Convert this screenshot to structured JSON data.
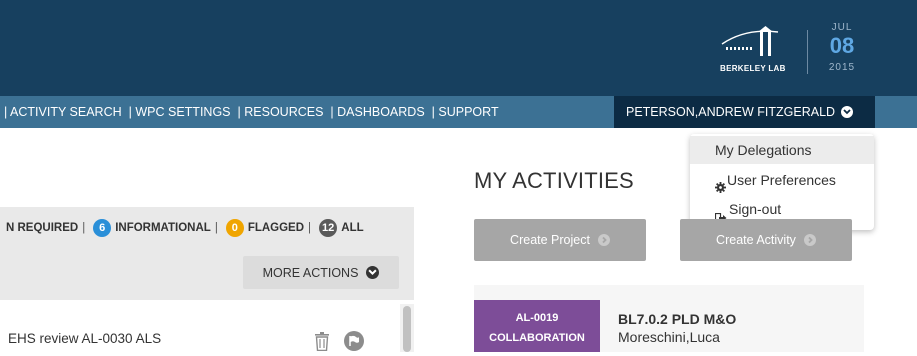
{
  "header": {
    "logo_text": "BERKELEY LAB",
    "date": {
      "month": "JUL",
      "day": "08",
      "year": "2015"
    }
  },
  "nav": {
    "items": [
      "| ACTIVITY SEARCH",
      "| WPC SETTINGS",
      "| RESOURCES",
      "| DASHBOARDS",
      "| SUPPORT"
    ],
    "user_name": "PETERSON,ANDREW FITZGERALD"
  },
  "user_dropdown": {
    "items": [
      {
        "label": "My Delegations",
        "icon": ""
      },
      {
        "label": "User Preferences",
        "icon": "gear-icon"
      },
      {
        "label": "Sign-out",
        "icon": "sign-out-icon"
      }
    ]
  },
  "main": {
    "heading": "MY ACTIVITIES",
    "create_project_label": "Create Project",
    "create_activity_label": "Create Activity"
  },
  "filters": {
    "action_required_label": "N REQUIRED",
    "informational_count": "6",
    "informational_label": "INFORMATIONAL",
    "flagged_count": "0",
    "flagged_label": "FLAGGED",
    "all_count": "12",
    "all_label": "ALL",
    "more_actions_label": "MORE ACTIONS"
  },
  "list": {
    "rows": [
      {
        "text": "EHS review AL-0030 ALS"
      }
    ]
  },
  "activity_card": {
    "tag_id": "AL-0019",
    "tag_type": "COLLABORATION",
    "title": "BL7.0.2 PLD M&O",
    "subtitle": "Moreschini,Luca"
  },
  "colors": {
    "header_bg": "#17405f",
    "nav_bg": "#3c7194",
    "user_menu_bg": "#0c2b44",
    "badge_blue": "#2a8fd8",
    "badge_orange": "#f0a500",
    "badge_dark": "#5a5a5a",
    "tag_purple": "#7d4d98"
  }
}
